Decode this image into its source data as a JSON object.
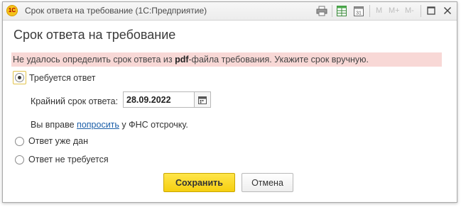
{
  "window": {
    "title": "Срок ответа на требование  (1С:Предприятие)",
    "app_icon": "1С",
    "toolbar": {
      "m_label": "M",
      "m_plus_label": "M+",
      "m_minus_label": "M-"
    }
  },
  "form": {
    "header": "Срок ответа на требование",
    "warning": {
      "before": "Не удалось определить срок ответа из ",
      "bold": "pdf",
      "after": "-файла требования. Укажите срок вручную."
    },
    "options": {
      "required": "Требуется ответ",
      "given": "Ответ уже дан",
      "not_required": "Ответ не требуется"
    },
    "selected_option": "required",
    "deadline_label": "Крайний срок ответа:",
    "deadline_value": "28.09.2022",
    "info": {
      "before": "Вы вправе ",
      "link": "попросить",
      "after": " у ФНС отсрочку."
    },
    "buttons": {
      "save": "Сохранить",
      "cancel": "Отмена"
    }
  },
  "colors": {
    "warning_bg": "#f8d8d6",
    "save_bg": "#f5cf10",
    "link": "#1c5fa8"
  }
}
